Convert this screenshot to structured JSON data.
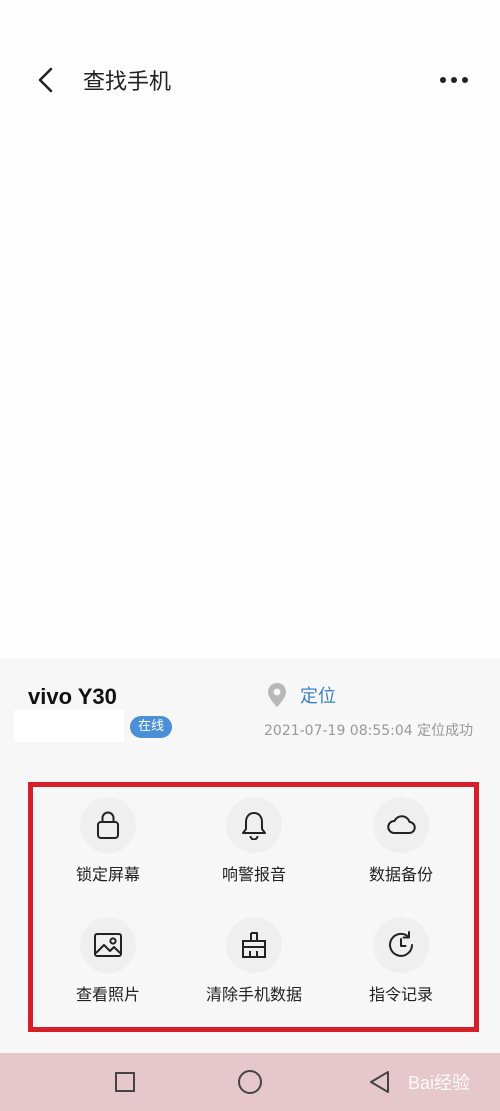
{
  "header": {
    "title": "查找手机",
    "back_icon": "chevron-left-icon",
    "more_icon": "more-horizontal-icon"
  },
  "device": {
    "name": "vivo Y30",
    "status": "在线",
    "locate_label": "定位",
    "locate_icon": "location-pin-icon",
    "locate_time": "2021-07-19 08:55:04 定位成功"
  },
  "actions": [
    {
      "label": "锁定屏幕",
      "icon": "lock-icon"
    },
    {
      "label": "响警报音",
      "icon": "bell-icon"
    },
    {
      "label": "数据备份",
      "icon": "cloud-icon"
    },
    {
      "label": "查看照片",
      "icon": "image-icon"
    },
    {
      "label": "清除手机数据",
      "icon": "brush-icon"
    },
    {
      "label": "指令记录",
      "icon": "history-icon"
    }
  ],
  "navbar": {
    "recent_icon": "square-icon",
    "home_icon": "circle-icon",
    "back_icon": "triangle-back-icon"
  },
  "watermark": "Bai经验",
  "colors": {
    "accent": "#4a90d9",
    "link": "#3b82c4",
    "highlight_border": "#d42029",
    "navbar_bg": "#e6c8cc"
  }
}
